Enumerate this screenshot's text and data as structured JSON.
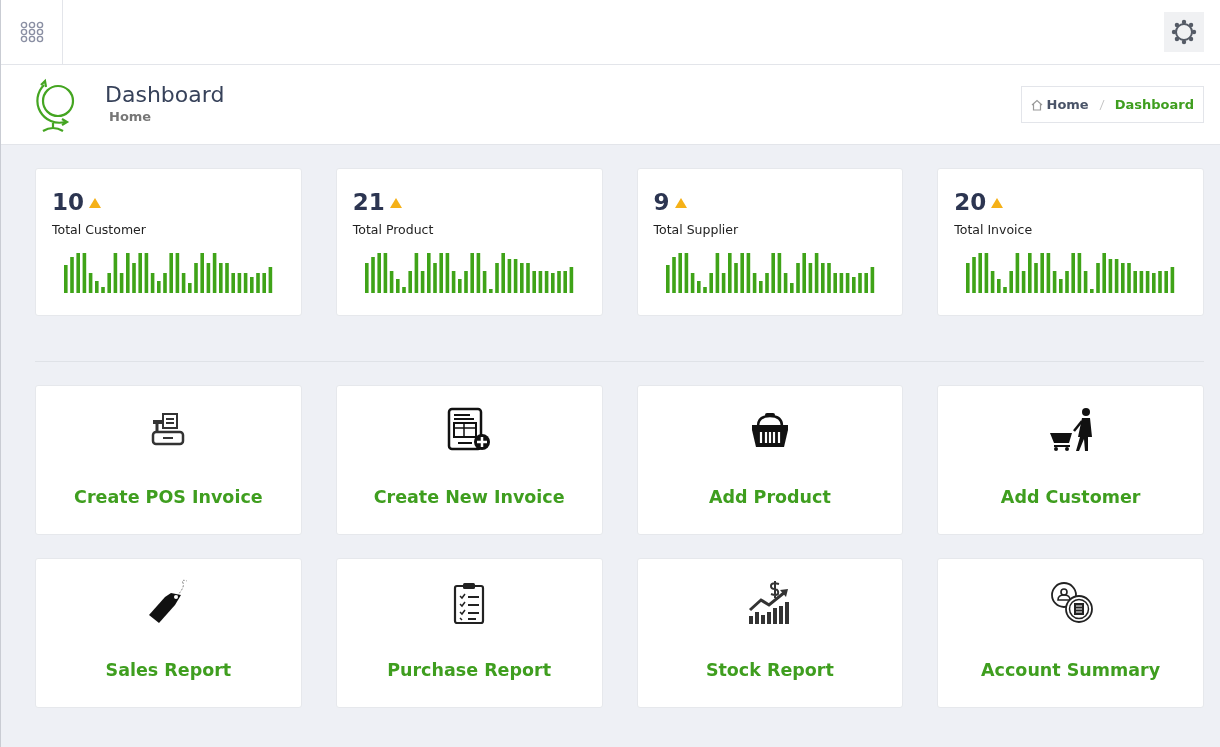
{
  "page_header": {
    "title": "Dashboard",
    "subtitle": "Home"
  },
  "breadcrumb": [
    {
      "label": "Home",
      "selected": false
    },
    {
      "label": "Dashboard",
      "selected": true
    }
  ],
  "stats": [
    {
      "value": "10",
      "label": "Total Customer"
    },
    {
      "value": "21",
      "label": "Total Product"
    },
    {
      "value": "9",
      "label": "Total Supplier"
    },
    {
      "value": "20",
      "label": "Total Invoice"
    }
  ],
  "shortcuts": [
    {
      "label": "Create POS Invoice",
      "kind": "register"
    },
    {
      "label": "Create New Invoice",
      "kind": "invoice"
    },
    {
      "label": "Add Product",
      "kind": "basket"
    },
    {
      "label": "Add Customer",
      "kind": "shopper"
    },
    {
      "label": "Sales Report",
      "kind": "tag"
    },
    {
      "label": "Purchase Report",
      "kind": "clipboard"
    },
    {
      "label": "Stock Report",
      "kind": "growth"
    },
    {
      "label": "Account Summary",
      "kind": "account"
    }
  ]
}
